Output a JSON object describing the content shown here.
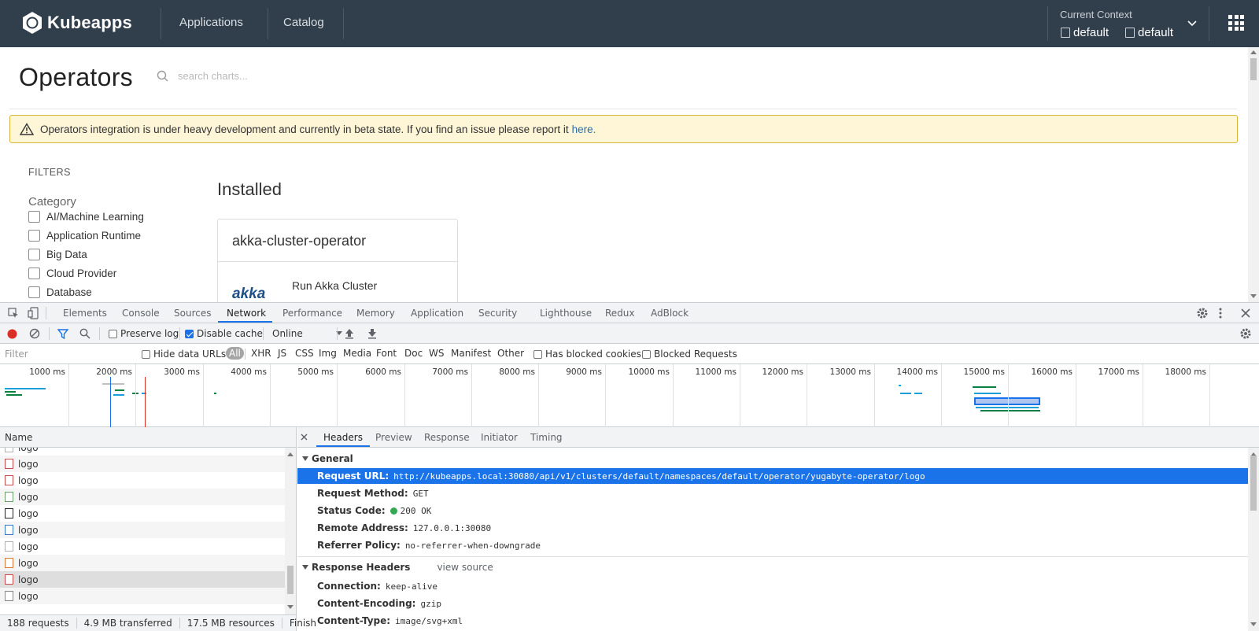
{
  "header": {
    "brand": "Kubeapps",
    "nav": [
      "Applications",
      "Catalog"
    ],
    "context_title": "Current Context",
    "context_cluster": "default",
    "context_namespace": "default"
  },
  "page": {
    "title": "Operators",
    "search_placeholder": "search charts...",
    "alert_text": "Operators integration is under heavy development and currently in beta state. If you find an issue please report it",
    "alert_link": "here.",
    "filters_heading": "FILTERS",
    "category_heading": "Category",
    "categories": [
      "AI/Machine Learning",
      "Application Runtime",
      "Big Data",
      "Cloud Provider",
      "Database"
    ],
    "installed_heading": "Installed",
    "card_title": "akka-cluster-operator",
    "card_logo": "akka",
    "card_desc": "Run Akka Cluster"
  },
  "devtools": {
    "tabs": [
      "Elements",
      "Console",
      "Sources",
      "Network",
      "Performance",
      "Memory",
      "Application",
      "Security",
      "Lighthouse",
      "Redux",
      "AdBlock"
    ],
    "active_tab": "Network",
    "toolbar": {
      "preserve_log": "Preserve log",
      "disable_cache": "Disable cache",
      "throttle": "Online"
    },
    "filter_bar": {
      "placeholder": "Filter",
      "hide_data_urls": "Hide data URLs",
      "types": [
        "All",
        "XHR",
        "JS",
        "CSS",
        "Img",
        "Media",
        "Font",
        "Doc",
        "WS",
        "Manifest",
        "Other"
      ],
      "has_blocked_cookies": "Has blocked cookies",
      "blocked_requests": "Blocked Requests"
    },
    "timeline_ticks": [
      "1000 ms",
      "2000 ms",
      "3000 ms",
      "4000 ms",
      "5000 ms",
      "6000 ms",
      "7000 ms",
      "8000 ms",
      "9000 ms",
      "10000 ms",
      "11000 ms",
      "12000 ms",
      "13000 ms",
      "14000 ms",
      "15000 ms",
      "16000 ms",
      "17000 ms",
      "18000 ms"
    ],
    "requests_header": "Name",
    "requests": [
      "logo",
      "logo",
      "logo",
      "logo",
      "logo",
      "logo",
      "logo",
      "logo",
      "logo",
      "logo"
    ],
    "status_bar": {
      "requests": "188 requests",
      "transferred": "4.9 MB transferred",
      "resources": "17.5 MB resources",
      "finish": "Finish"
    },
    "detail_tabs": [
      "Headers",
      "Preview",
      "Response",
      "Initiator",
      "Timing"
    ],
    "general_heading": "General",
    "general": [
      {
        "k": "Request URL:",
        "v": "http://kubeapps.local:30080/api/v1/clusters/default/namespaces/default/operator/yugabyte-operator/logo"
      },
      {
        "k": "Request Method:",
        "v": "GET"
      },
      {
        "k": "Status Code:",
        "v": "200 OK"
      },
      {
        "k": "Remote Address:",
        "v": "127.0.0.1:30080"
      },
      {
        "k": "Referrer Policy:",
        "v": "no-referrer-when-downgrade"
      }
    ],
    "response_heading": "Response Headers",
    "view_source": "view source",
    "response": [
      {
        "k": "Connection:",
        "v": "keep-alive"
      },
      {
        "k": "Content-Encoding:",
        "v": "gzip"
      },
      {
        "k": "Content-Type:",
        "v": "image/svg+xml"
      }
    ]
  }
}
